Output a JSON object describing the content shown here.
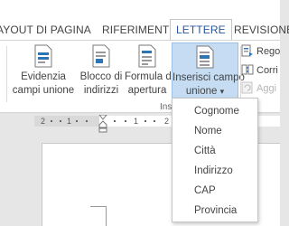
{
  "tabs": [
    {
      "label": "AYOUT DI PAGINA"
    },
    {
      "label": "RIFERIMENTI"
    },
    {
      "label": "LETTERE"
    },
    {
      "label": "REVISIONE"
    }
  ],
  "ribbon": {
    "buttons": [
      {
        "line1": "Evidenzia",
        "line2": "campi unione",
        "icon": "highlight-fields-icon"
      },
      {
        "line1": "Blocco di",
        "line2": "indirizzi",
        "icon": "address-block-icon"
      },
      {
        "line1": "Formula di",
        "line2": "apertura",
        "icon": "greeting-line-icon"
      },
      {
        "line1": "Inserisci campo",
        "line2": "unione",
        "icon": "insert-merge-field-icon",
        "arrow": "▾"
      }
    ],
    "small_buttons": [
      {
        "label": "Rego",
        "icon": "rules-icon",
        "disabled": false
      },
      {
        "label": "Corri",
        "icon": "match-fields-icon",
        "disabled": false
      },
      {
        "label": "Aggi",
        "icon": "update-labels-icon",
        "disabled": true
      }
    ],
    "group_label": "Ins"
  },
  "ruler": {
    "left_number": "2",
    "numbers": [
      "1",
      "1",
      "2",
      "3",
      "4",
      "5"
    ]
  },
  "merge_field_menu": {
    "items": [
      "Cognome",
      "Nome",
      "Città",
      "Indirizzo",
      "CAP",
      "Provincia"
    ]
  },
  "colors": {
    "accent": "#2b579a",
    "selected_bg": "#c5dcf2",
    "icon_blue": "#2e75b6"
  }
}
